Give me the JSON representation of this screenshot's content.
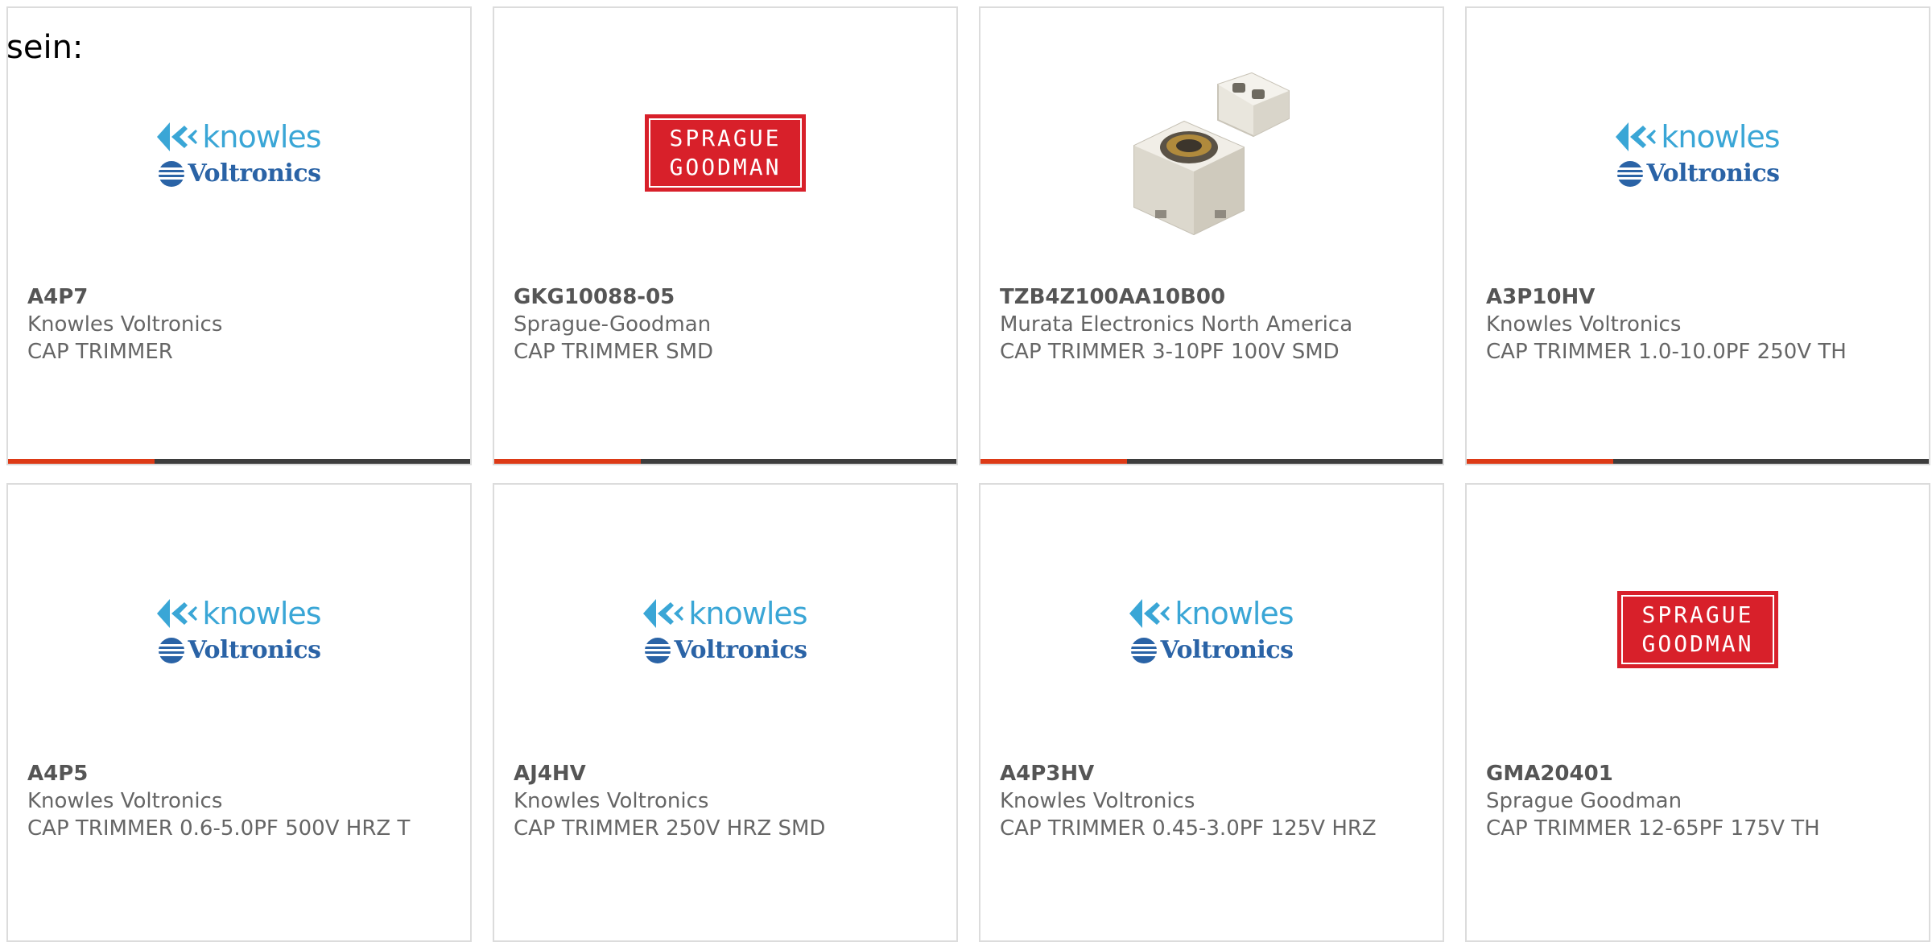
{
  "intro_text": "sein:",
  "colors": {
    "accent_bar": "#dd3a16",
    "dark_bar": "#3d3d3d",
    "knowles_blue": "#3aa6d6",
    "voltronics_blue": "#2a63a6",
    "sprague_red": "#d8202a"
  },
  "logo_text": {
    "knowles": "knowles",
    "voltronics": "Voltronics",
    "sprague_line1": "SPRAGUE",
    "sprague_line2": "GOODMAN"
  },
  "products": [
    {
      "part": "A4P7",
      "manufacturer": "Knowles Voltronics",
      "description": "CAP TRIMMER",
      "logo": "knowles-voltronics-logo"
    },
    {
      "part": "GKG10088-05",
      "manufacturer": "Sprague-Goodman",
      "description": "CAP TRIMMER SMD",
      "logo": "sprague-goodman-logo"
    },
    {
      "part": "TZB4Z100AA10B00",
      "manufacturer": "Murata Electronics North America",
      "description": "CAP TRIMMER 3-10PF 100V SMD",
      "logo": "trimmer-capacitor-photo"
    },
    {
      "part": "A3P10HV",
      "manufacturer": "Knowles Voltronics",
      "description": "CAP TRIMMER 1.0-10.0PF 250V TH",
      "logo": "knowles-voltronics-logo"
    },
    {
      "part": "A4P5",
      "manufacturer": "Knowles Voltronics",
      "description": "CAP TRIMMER 0.6-5.0PF 500V HRZ T",
      "logo": "knowles-voltronics-logo"
    },
    {
      "part": "AJ4HV",
      "manufacturer": "Knowles Voltronics",
      "description": "CAP TRIMMER 250V HRZ SMD",
      "logo": "knowles-voltronics-logo"
    },
    {
      "part": "A4P3HV",
      "manufacturer": "Knowles Voltronics",
      "description": "CAP TRIMMER 0.45-3.0PF 125V HRZ",
      "logo": "knowles-voltronics-logo"
    },
    {
      "part": "GMA20401",
      "manufacturer": "Sprague Goodman",
      "description": "CAP TRIMMER 12-65PF 175V TH",
      "logo": "sprague-goodman-logo"
    }
  ]
}
